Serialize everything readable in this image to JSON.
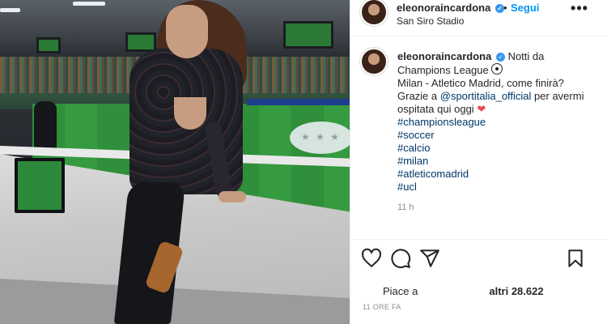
{
  "post": {
    "username": "eleonoraincardona",
    "location": "San Siro Stadio",
    "follow_label": "Segui",
    "dot": "•",
    "more_label": "•••",
    "verified_glyph": "✓"
  },
  "caption": {
    "username": "eleonoraincardona",
    "line1": "Notti da",
    "line2": "Champions League",
    "line3": "Milan - Atletico Madrid, come finirà?",
    "line4_prefix": "Grazie a ",
    "mention": "@sportitalia_official",
    "line4_suffix": " per avermi",
    "line5": "ospitata qui oggi",
    "heart": "❤",
    "hashtags": [
      "#championsleague",
      "#soccer",
      "#calcio",
      "#milan",
      "#atleticomadrid",
      "#ucl"
    ],
    "time_ago": "11 h"
  },
  "actions": {
    "icons": [
      "heart-icon",
      "comment-icon",
      "share-icon",
      "bookmark-icon"
    ]
  },
  "likes": {
    "prefix": "Piace a",
    "suffix": "altri 28.622"
  },
  "posted_label": "11 ORE FA",
  "colors": {
    "accent": "#0095f6",
    "link": "#00376b",
    "muted": "#8e8e8e",
    "heart": "#ed4956"
  }
}
